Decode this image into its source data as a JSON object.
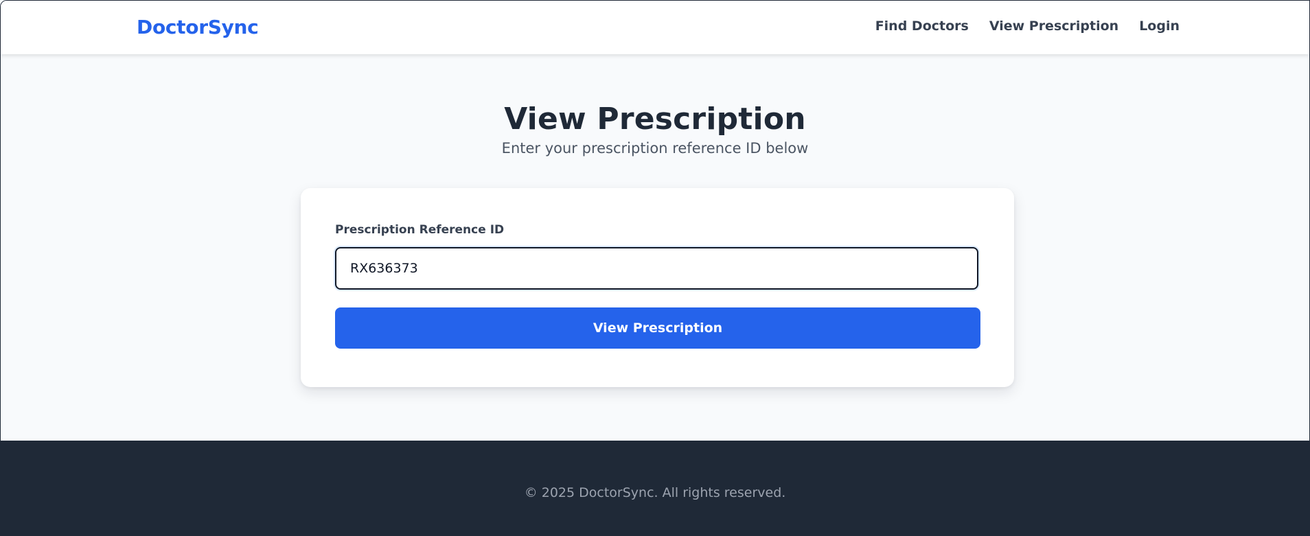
{
  "header": {
    "brand": "DoctorSync",
    "nav": {
      "find_doctors": "Find Doctors",
      "view_prescription": "View Prescription",
      "login": "Login"
    }
  },
  "main": {
    "title": "View Prescription",
    "subtitle": "Enter your prescription reference ID below",
    "form": {
      "label": "Prescription Reference ID",
      "input_value": "RX636373",
      "submit_label": "View Prescription"
    }
  },
  "footer": {
    "copyright": "© 2025 DoctorSync. All rights reserved."
  },
  "colors": {
    "brand": "#2563eb",
    "button": "#2563eb",
    "footer_bg": "#1f2937",
    "page_bg": "#f8fafc"
  }
}
